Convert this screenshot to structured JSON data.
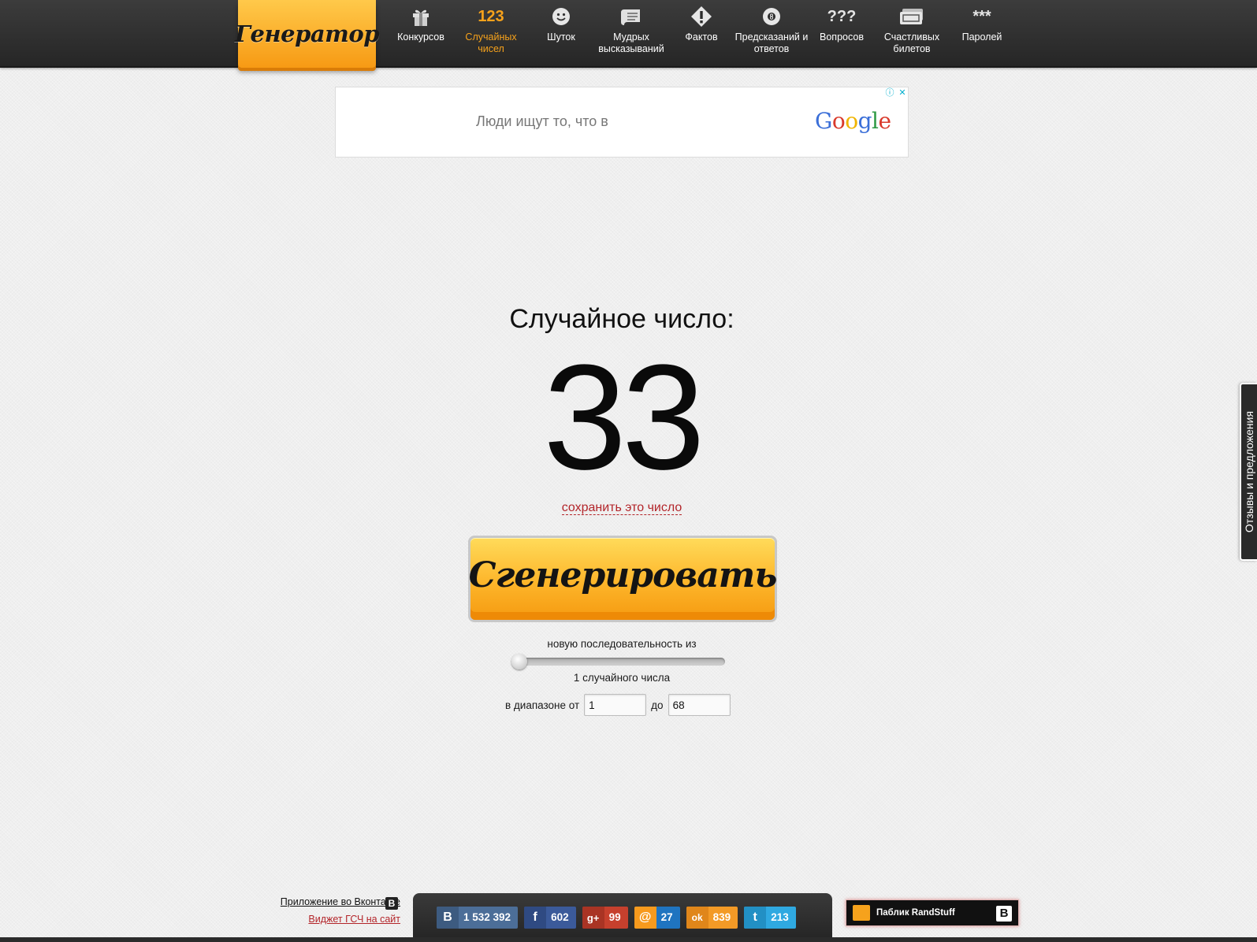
{
  "header": {
    "logo": "Генератор",
    "nav": [
      {
        "label": "Конкурсов",
        "icon": "gift-icon"
      },
      {
        "label": "Случайных чисел",
        "icon": "numbers-icon",
        "icon_text": "123",
        "active": true
      },
      {
        "label": "Шуток",
        "icon": "smiley-icon"
      },
      {
        "label": "Мудрых высказываний",
        "icon": "scroll-icon"
      },
      {
        "label": "Фактов",
        "icon": "warning-diamond-icon"
      },
      {
        "label": "Предсказаний и ответов",
        "icon": "magic-8-ball-icon"
      },
      {
        "label": "Вопросов",
        "icon": "question-marks-icon",
        "icon_text": "???"
      },
      {
        "label": "Счастливых билетов",
        "icon": "tickets-icon"
      },
      {
        "label": "Паролей",
        "icon": "asterisks-icon",
        "icon_text": "***"
      }
    ]
  },
  "ad": {
    "text": "Люди ищут то, что в",
    "brand": "Google"
  },
  "main": {
    "result_label": "Случайное число:",
    "result_value": "33",
    "save_link": "сохранить это число",
    "generate_button": "Сгенерировать",
    "sequence_label": "новую последовательность из",
    "count_label": "1 случайного числа",
    "slider_value": 1,
    "range_from_label": "в диапазоне от",
    "range_from_value": "1",
    "range_to_label": "до",
    "range_to_value": "68"
  },
  "feedback_tab": "Отзывы и предложения",
  "footer": {
    "vk_app_link": "Приложение во Вконтакте",
    "vk_letter": "B",
    "widget_link": "Виджет ГСЧ на сайт",
    "shares": [
      {
        "network": "vk",
        "icon": "vk-icon",
        "glyph": "B",
        "count": "1 532 392",
        "color": "#4c6e98"
      },
      {
        "network": "facebook",
        "icon": "facebook-icon",
        "glyph": "f",
        "count": "602",
        "color": "#3b5a9a"
      },
      {
        "network": "google-plus",
        "icon": "google-plus-icon",
        "glyph": "g+",
        "count": "99",
        "color": "#c6402d"
      },
      {
        "network": "mail",
        "icon": "mail-at-icon",
        "glyph": "@",
        "count": "27",
        "color": "#1f74c0"
      },
      {
        "network": "odnoklassniki",
        "icon": "odnoklassniki-icon",
        "glyph": "ok",
        "count": "839",
        "color": "#f39a26"
      },
      {
        "network": "twitter",
        "icon": "twitter-icon",
        "glyph": "t",
        "count": "213",
        "color": "#2fa9e1"
      }
    ],
    "public_label": "Паблик RandStuff",
    "public_vk": "B"
  }
}
